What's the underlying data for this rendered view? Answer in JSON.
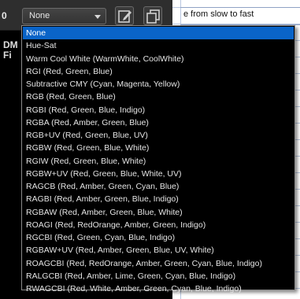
{
  "toolbar": {
    "value_label": "0",
    "select": {
      "selected": "None"
    },
    "icons": {
      "edit": "edit-icon",
      "copy": "copy-icon"
    }
  },
  "side": {
    "title_line1": "DM",
    "title_line2": "Fi"
  },
  "sheet": {
    "cell_text": "e from slow to fast"
  },
  "dropdown": {
    "options": [
      "None",
      "Hue-Sat",
      "Warm Cool White (WarmWhite, CoolWhite)",
      "RGI (Red, Green, Blue)",
      "Subtractive CMY (Cyan, Magenta, Yellow)",
      "RGB (Red, Green, Blue)",
      "RGBI (Red, Green, Blue, Indigo)",
      "RGBA (Red, Amber, Green, Blue)",
      "RGB+UV (Red, Green, Blue, UV)",
      "RGBW (Red, Green, Blue, White)",
      "RGIW (Red, Green, Blue, White)",
      "RGBW+UV (Red, Green, Blue, White, UV)",
      "RAGCB (Red, Amber, Green, Cyan, Blue)",
      "RAGBI (Red, Amber, Green, Blue, Indigo)",
      "RGBAW (Red, Amber, Green, Blue, White)",
      "ROAGI (Red, RedOrange, Amber, Green, Indigo)",
      "RGCBI (Red, Green, Cyan, Blue, Indigo)",
      "RGBAW+UV (Red, Amber, Green, Blue, UV, White)",
      "ROAGCBI (Red, RedOrange, Amber, Green, Cyan, Blue, Indigo)",
      "RALGCBI (Red, Amber, Lime, Green, Cyan, Blue, Indigo)",
      "RWAGCBI (Red, White, Amber, Green, Cyan, Blue, Indigo)"
    ],
    "selected_index": 0
  },
  "colors": {
    "highlight": "#0a64c8",
    "list_bg": "#000000",
    "list_text": "#e4e4e4"
  }
}
